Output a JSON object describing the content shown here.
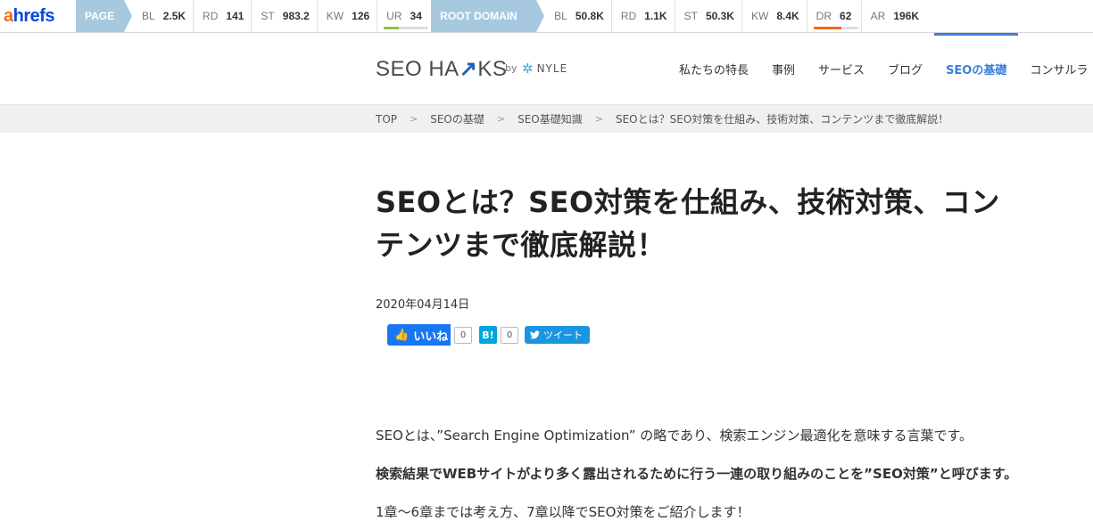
{
  "ahrefs": {
    "logo_a": "a",
    "logo_rest": "hrefs",
    "page_label": "PAGE",
    "page_metrics": [
      {
        "key": "BL",
        "value": "2.5K"
      },
      {
        "key": "RD",
        "value": "141"
      },
      {
        "key": "ST",
        "value": "983.2"
      },
      {
        "key": "KW",
        "value": "126"
      },
      {
        "key": "UR",
        "value": "34",
        "bar_fraction": 0.34,
        "bar_color": "#8cc152"
      }
    ],
    "root_label": "ROOT DOMAIN",
    "root_metrics": [
      {
        "key": "BL",
        "value": "50.8K"
      },
      {
        "key": "RD",
        "value": "1.1K"
      },
      {
        "key": "ST",
        "value": "50.3K"
      },
      {
        "key": "KW",
        "value": "8.4K"
      },
      {
        "key": "DR",
        "value": "62",
        "bar_fraction": 0.62,
        "bar_color": "#f26b1d"
      },
      {
        "key": "AR",
        "value": "196K"
      }
    ]
  },
  "header": {
    "logo_left": "SEO HA",
    "logo_mark": "↗",
    "logo_right": "KS",
    "by": "by",
    "partner": "NYLE",
    "nav": [
      {
        "label": "私たちの特長",
        "active": false
      },
      {
        "label": "事例",
        "active": false
      },
      {
        "label": "サービス",
        "active": false
      },
      {
        "label": "ブログ",
        "active": false
      },
      {
        "label": "SEOの基礎",
        "active": true
      },
      {
        "label": "コンサルラ",
        "active": false
      }
    ]
  },
  "breadcrumb": [
    "TOP",
    "SEOの基礎",
    "SEO基礎知識",
    "SEOとは？SEO対策を仕組み、技術対策、コンテンツまで徹底解説！"
  ],
  "article": {
    "title_line1": "SEOとは？SEO対策を仕組み、技術対策、コン",
    "title_line2": "テンツまで徹底解説！",
    "date": "2020年04月14日",
    "fb_label": "いいね",
    "fb_count": "0",
    "hatena_label": "B!",
    "hatena_count": "0",
    "tweet_label": "ツイート",
    "p1": "SEOとは、”Search Engine Optimization” の略であり、検索エンジン最適化を意味する言葉です。",
    "p2": "検索結果でWEBサイトがより多く露出されるために行う一連の取り組みのことを”SEO対策”と呼びます。",
    "p3": "1章〜6章までは考え方、7章以降でSEO対策をご紹介します！"
  },
  "icons": {
    "thumb": "thumbs-up-icon",
    "twitter": "twitter-bird-icon",
    "nyle": "nyle-star-icon"
  }
}
